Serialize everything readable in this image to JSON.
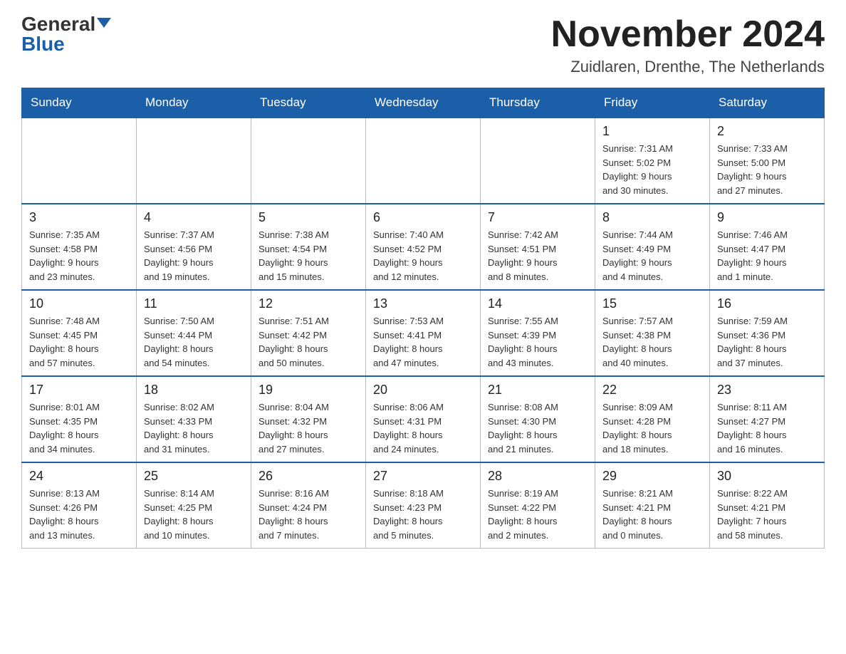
{
  "header": {
    "logo_general": "General",
    "logo_blue": "Blue",
    "month_title": "November 2024",
    "location": "Zuidlaren, Drenthe, The Netherlands"
  },
  "weekdays": [
    "Sunday",
    "Monday",
    "Tuesday",
    "Wednesday",
    "Thursday",
    "Friday",
    "Saturday"
  ],
  "weeks": [
    [
      {
        "day": "",
        "info": ""
      },
      {
        "day": "",
        "info": ""
      },
      {
        "day": "",
        "info": ""
      },
      {
        "day": "",
        "info": ""
      },
      {
        "day": "",
        "info": ""
      },
      {
        "day": "1",
        "info": "Sunrise: 7:31 AM\nSunset: 5:02 PM\nDaylight: 9 hours\nand 30 minutes."
      },
      {
        "day": "2",
        "info": "Sunrise: 7:33 AM\nSunset: 5:00 PM\nDaylight: 9 hours\nand 27 minutes."
      }
    ],
    [
      {
        "day": "3",
        "info": "Sunrise: 7:35 AM\nSunset: 4:58 PM\nDaylight: 9 hours\nand 23 minutes."
      },
      {
        "day": "4",
        "info": "Sunrise: 7:37 AM\nSunset: 4:56 PM\nDaylight: 9 hours\nand 19 minutes."
      },
      {
        "day": "5",
        "info": "Sunrise: 7:38 AM\nSunset: 4:54 PM\nDaylight: 9 hours\nand 15 minutes."
      },
      {
        "day": "6",
        "info": "Sunrise: 7:40 AM\nSunset: 4:52 PM\nDaylight: 9 hours\nand 12 minutes."
      },
      {
        "day": "7",
        "info": "Sunrise: 7:42 AM\nSunset: 4:51 PM\nDaylight: 9 hours\nand 8 minutes."
      },
      {
        "day": "8",
        "info": "Sunrise: 7:44 AM\nSunset: 4:49 PM\nDaylight: 9 hours\nand 4 minutes."
      },
      {
        "day": "9",
        "info": "Sunrise: 7:46 AM\nSunset: 4:47 PM\nDaylight: 9 hours\nand 1 minute."
      }
    ],
    [
      {
        "day": "10",
        "info": "Sunrise: 7:48 AM\nSunset: 4:45 PM\nDaylight: 8 hours\nand 57 minutes."
      },
      {
        "day": "11",
        "info": "Sunrise: 7:50 AM\nSunset: 4:44 PM\nDaylight: 8 hours\nand 54 minutes."
      },
      {
        "day": "12",
        "info": "Sunrise: 7:51 AM\nSunset: 4:42 PM\nDaylight: 8 hours\nand 50 minutes."
      },
      {
        "day": "13",
        "info": "Sunrise: 7:53 AM\nSunset: 4:41 PM\nDaylight: 8 hours\nand 47 minutes."
      },
      {
        "day": "14",
        "info": "Sunrise: 7:55 AM\nSunset: 4:39 PM\nDaylight: 8 hours\nand 43 minutes."
      },
      {
        "day": "15",
        "info": "Sunrise: 7:57 AM\nSunset: 4:38 PM\nDaylight: 8 hours\nand 40 minutes."
      },
      {
        "day": "16",
        "info": "Sunrise: 7:59 AM\nSunset: 4:36 PM\nDaylight: 8 hours\nand 37 minutes."
      }
    ],
    [
      {
        "day": "17",
        "info": "Sunrise: 8:01 AM\nSunset: 4:35 PM\nDaylight: 8 hours\nand 34 minutes."
      },
      {
        "day": "18",
        "info": "Sunrise: 8:02 AM\nSunset: 4:33 PM\nDaylight: 8 hours\nand 31 minutes."
      },
      {
        "day": "19",
        "info": "Sunrise: 8:04 AM\nSunset: 4:32 PM\nDaylight: 8 hours\nand 27 minutes."
      },
      {
        "day": "20",
        "info": "Sunrise: 8:06 AM\nSunset: 4:31 PM\nDaylight: 8 hours\nand 24 minutes."
      },
      {
        "day": "21",
        "info": "Sunrise: 8:08 AM\nSunset: 4:30 PM\nDaylight: 8 hours\nand 21 minutes."
      },
      {
        "day": "22",
        "info": "Sunrise: 8:09 AM\nSunset: 4:28 PM\nDaylight: 8 hours\nand 18 minutes."
      },
      {
        "day": "23",
        "info": "Sunrise: 8:11 AM\nSunset: 4:27 PM\nDaylight: 8 hours\nand 16 minutes."
      }
    ],
    [
      {
        "day": "24",
        "info": "Sunrise: 8:13 AM\nSunset: 4:26 PM\nDaylight: 8 hours\nand 13 minutes."
      },
      {
        "day": "25",
        "info": "Sunrise: 8:14 AM\nSunset: 4:25 PM\nDaylight: 8 hours\nand 10 minutes."
      },
      {
        "day": "26",
        "info": "Sunrise: 8:16 AM\nSunset: 4:24 PM\nDaylight: 8 hours\nand 7 minutes."
      },
      {
        "day": "27",
        "info": "Sunrise: 8:18 AM\nSunset: 4:23 PM\nDaylight: 8 hours\nand 5 minutes."
      },
      {
        "day": "28",
        "info": "Sunrise: 8:19 AM\nSunset: 4:22 PM\nDaylight: 8 hours\nand 2 minutes."
      },
      {
        "day": "29",
        "info": "Sunrise: 8:21 AM\nSunset: 4:21 PM\nDaylight: 8 hours\nand 0 minutes."
      },
      {
        "day": "30",
        "info": "Sunrise: 8:22 AM\nSunset: 4:21 PM\nDaylight: 7 hours\nand 58 minutes."
      }
    ]
  ]
}
